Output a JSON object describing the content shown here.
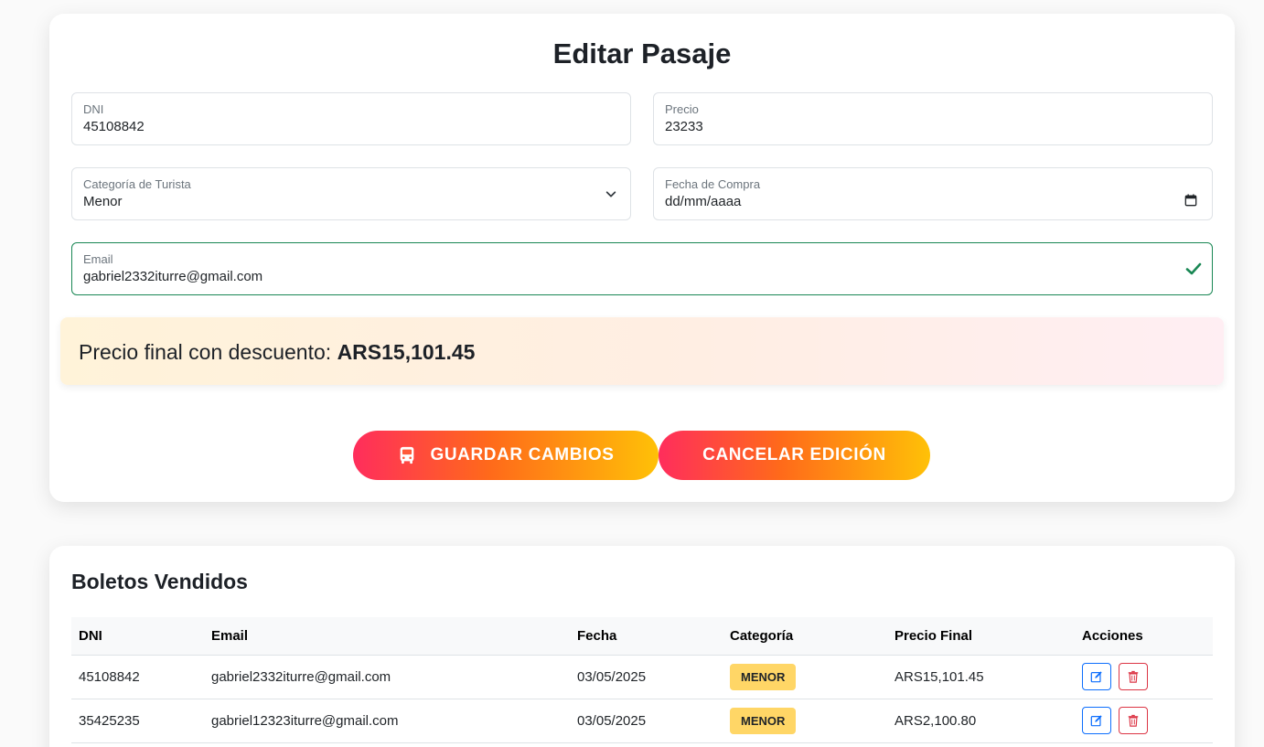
{
  "form": {
    "title": "Editar Pasaje",
    "dni": {
      "label": "DNI",
      "value": "45108842"
    },
    "precio": {
      "label": "Precio",
      "value": "23233"
    },
    "categoria": {
      "label": "Categoría de Turista",
      "value": "Menor"
    },
    "fecha": {
      "label": "Fecha de Compra",
      "value": "dd/mm/aaaa"
    },
    "email": {
      "label": "Email",
      "value": "gabriel2332iturre@gmail.com",
      "valid": true
    },
    "total": {
      "label": "Precio final con descuento:",
      "amount": "ARS15,101.45"
    },
    "save_label": "GUARDAR CAMBIOS",
    "cancel_label": "CANCELAR EDICIÓN",
    "save_icon": "bus-icon"
  },
  "tickets": {
    "title": "Boletos Vendidos",
    "columns": [
      "DNI",
      "Email",
      "Fecha",
      "Categoría",
      "Precio Final",
      "Acciones"
    ],
    "rows": [
      {
        "dni": "45108842",
        "email": "gabriel2332iturre@gmail.com",
        "fecha": "03/05/2025",
        "categoria": "MENOR",
        "precio": "ARS15,101.45"
      },
      {
        "dni": "35425235",
        "email": "gabriel12323iturre@gmail.com",
        "fecha": "03/05/2025",
        "categoria": "MENOR",
        "precio": "ARS2,100.80"
      }
    ],
    "actions": [
      "edit-icon",
      "trash-icon"
    ]
  },
  "colors": {
    "gradient_start": "#ff2d5c",
    "gradient_mid": "#ff6a1a",
    "gradient_end": "#ffc107",
    "valid": "#198754",
    "edit": "#0d6efd",
    "delete": "#dc3545",
    "badge": "#ffd666"
  }
}
